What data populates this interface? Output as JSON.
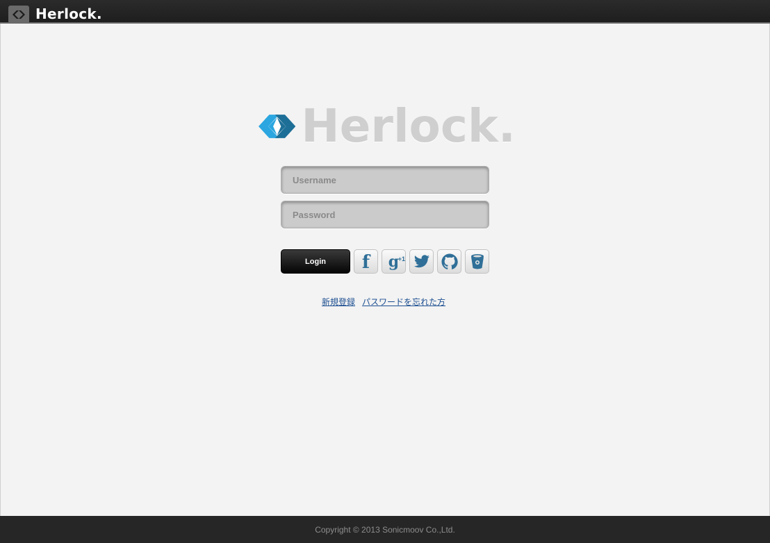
{
  "header": {
    "brand": "Herlock."
  },
  "logo": {
    "word": "Herlock.",
    "colors": {
      "primary": "#2ba6e0",
      "dark": "#1d6f97",
      "text": "#cfcfcf"
    }
  },
  "login_form": {
    "username_placeholder": "Username",
    "password_placeholder": "Password",
    "login_label": "Login"
  },
  "social": {
    "facebook_icon": "facebook-icon",
    "google_plus_icon": "google-plus-icon",
    "google_plus_glyph": "g",
    "google_plus_sup": "+1",
    "twitter_icon": "twitter-icon",
    "github_icon": "github-icon",
    "bitbucket_icon": "bitbucket-icon",
    "icon_color": "#2f6f98"
  },
  "links": {
    "register": "新規登録",
    "forgot_password": "パスワードを忘れた方"
  },
  "footer": {
    "copyright": "Copyright © 2013 Sonicmoov Co.,Ltd."
  }
}
